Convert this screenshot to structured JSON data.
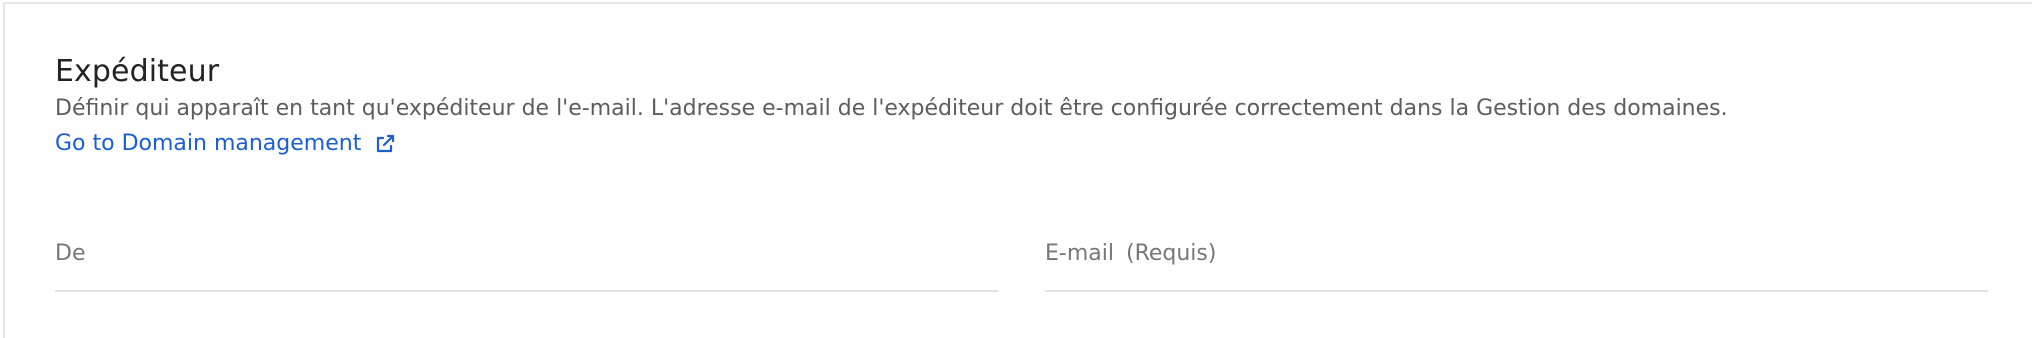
{
  "sender": {
    "title": "Expéditeur",
    "description": "Définir qui apparaît en tant qu'expéditeur de l'e-mail. L'adresse e-mail de l'expéditeur doit être configurée correctement dans la Gestion des domaines.",
    "domain_link": {
      "label": "Go to Domain management",
      "icon": "external-link-icon",
      "color": "#1a5fd1"
    },
    "fields": {
      "from": {
        "label": "De",
        "value": ""
      },
      "email": {
        "label": "E-mail",
        "required_label": "(Requis)",
        "value": ""
      }
    }
  }
}
